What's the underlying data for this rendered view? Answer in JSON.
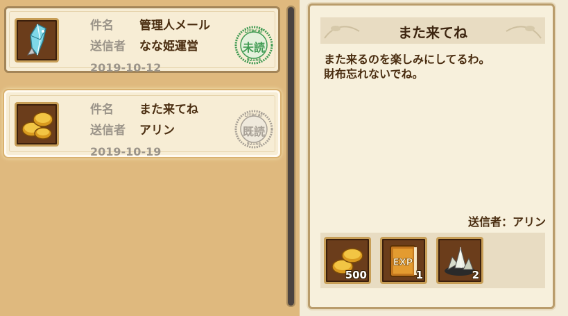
{
  "mail_list": {
    "items": [
      {
        "subject_label": "件名",
        "subject": "管理人メール",
        "sender_label": "送信者",
        "sender": "なな姫運営",
        "date": "2019-10-12",
        "stamp": "未読",
        "stamp_color": "#3f9a52",
        "icon": "crystal-icon"
      },
      {
        "subject_label": "件名",
        "subject": "また来てね",
        "sender_label": "送信者",
        "sender": "アリン",
        "date": "2019-10-19",
        "stamp": "既読",
        "stamp_color": "#a7a096",
        "icon": "gold-coins-icon"
      }
    ]
  },
  "detail": {
    "title": "また来てね",
    "body_line1": "また来るのを楽しみにしてるわ。",
    "body_line2": "財布忘れないでね。",
    "sender_text": "送信者：アリン",
    "rewards": [
      {
        "icon": "gold-coins-icon",
        "qty": "500"
      },
      {
        "icon": "exp-book-icon",
        "qty": "1"
      },
      {
        "icon": "ore-crystal-icon",
        "qty": "2"
      }
    ]
  }
}
